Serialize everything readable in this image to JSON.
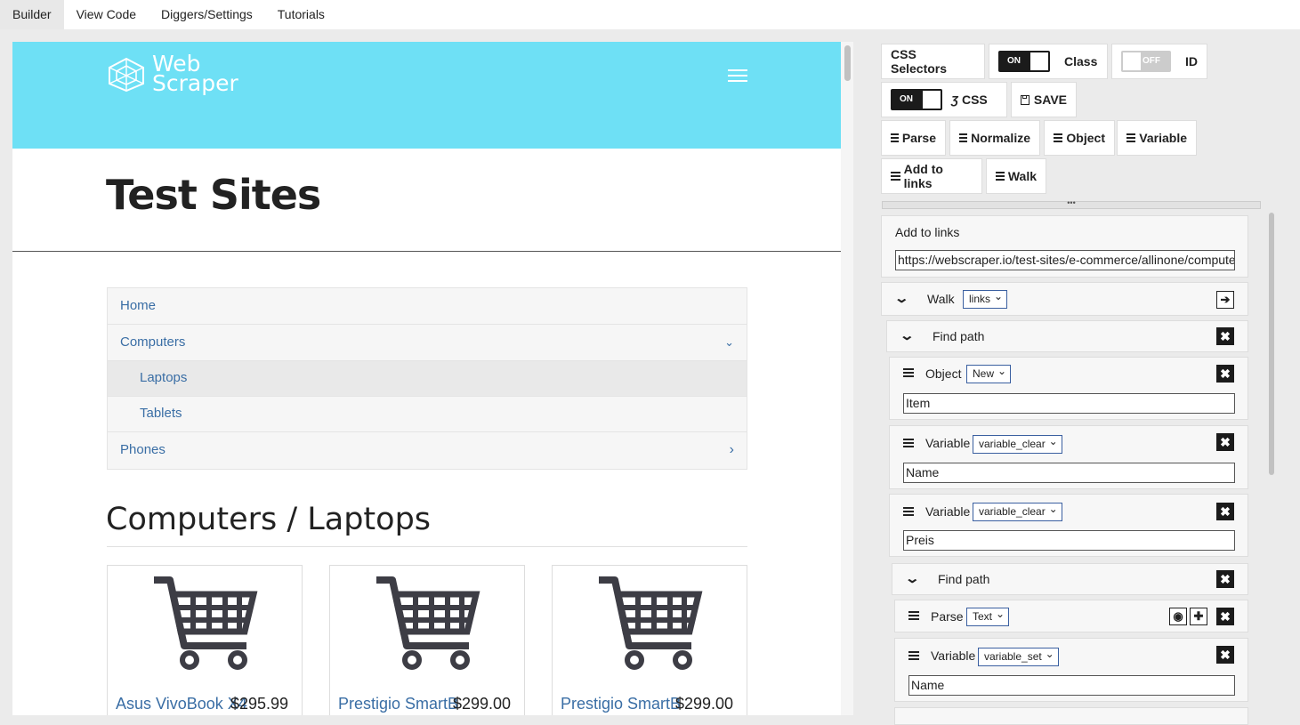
{
  "tabs": [
    "Builder",
    "View Code",
    "Diggers/Settings",
    "Tutorials"
  ],
  "preview": {
    "logo_line1": "Web",
    "logo_line2": "Scraper",
    "title": "Test Sites",
    "nav": [
      {
        "label": "Home",
        "chev": ""
      },
      {
        "label": "Computers",
        "chev": "⌄"
      },
      {
        "label": "Laptops",
        "chev": ""
      },
      {
        "label": "Tablets",
        "chev": ""
      },
      {
        "label": "Phones",
        "chev": "›"
      }
    ],
    "section_title": "Computers / Laptops",
    "products": [
      {
        "name": "Asus VivoBook X4",
        "price": "$295.99"
      },
      {
        "name": "Prestigio SmartB",
        "price": "$299.00"
      },
      {
        "name": "Prestigio SmartB",
        "price": "$299.00"
      }
    ]
  },
  "panel": {
    "css_selectors": "CSS Selectors",
    "class_toggle": "ON",
    "class_label": "Class",
    "id_toggle": "OFF",
    "id_label": "ID",
    "css_toggle": "ON",
    "css_label": "CSS",
    "save_label": "SAVE",
    "parse_btn": "Parse",
    "normalize_btn": "Normalize",
    "object_btn": "Object",
    "variable_btn": "Variable",
    "add_links_btn": "Add to links",
    "walk_btn": "Walk",
    "splitter": "•••",
    "add_to_links_title": "Add to links",
    "add_to_links_url": "https://webscraper.io/test-sites/e-commerce/allinone/computers/laptops",
    "walk_label": "Walk",
    "walk_select": "links",
    "find_path_1": "Find path",
    "object_label": "Object",
    "object_select": "New",
    "object_value": "Item",
    "variable_label": "Variable",
    "variable_select_1": "variable_clear",
    "variable_value_1": "Name",
    "variable_select_2": "variable_clear",
    "variable_value_2": "Preis",
    "find_path_2": "Find path",
    "parse_label": "Parse",
    "parse_select": "Text",
    "variable_select_3": "variable_set",
    "variable_value_3": "Name"
  }
}
